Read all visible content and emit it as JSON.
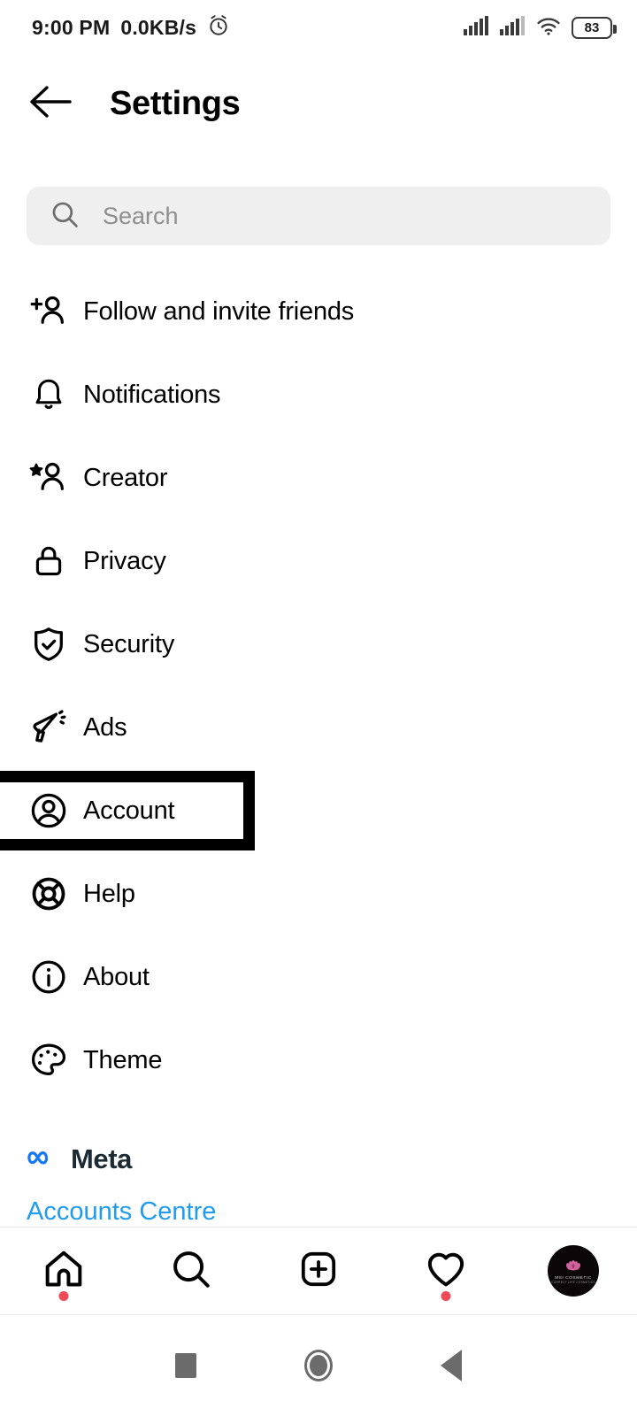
{
  "status_bar": {
    "time": "9:00 PM",
    "network_speed": "0.0KB/s",
    "alarm_icon": "alarm-clock-icon",
    "signal_1_icon": "signal-bars-icon",
    "signal_2_icon": "signal-bars-icon",
    "wifi_icon": "wifi-icon",
    "battery_level": "83"
  },
  "header": {
    "back_icon": "back-arrow-icon",
    "title": "Settings"
  },
  "search": {
    "icon": "search-icon",
    "placeholder": "Search",
    "value": ""
  },
  "settings_list": {
    "items": [
      {
        "label": "Follow and invite friends",
        "icon": "person-add-icon",
        "highlighted": false
      },
      {
        "label": "Notifications",
        "icon": "bell-icon",
        "highlighted": false
      },
      {
        "label": "Creator",
        "icon": "person-star-icon",
        "highlighted": false
      },
      {
        "label": "Privacy",
        "icon": "lock-icon",
        "highlighted": false
      },
      {
        "label": "Security",
        "icon": "shield-check-icon",
        "highlighted": false
      },
      {
        "label": "Ads",
        "icon": "megaphone-icon",
        "highlighted": false
      },
      {
        "label": "Account",
        "icon": "account-circle-icon",
        "highlighted": true
      },
      {
        "label": "Help",
        "icon": "life-ring-icon",
        "highlighted": false
      },
      {
        "label": "About",
        "icon": "info-circle-icon",
        "highlighted": false
      },
      {
        "label": "Theme",
        "icon": "palette-icon",
        "highlighted": false
      }
    ]
  },
  "footer": {
    "meta_logo_icon": "meta-infinity-icon",
    "meta_label": "Meta",
    "accounts_centre_label": "Accounts Centre",
    "link_color": "#1f9bf0",
    "meta_logo_color": "#1877f2"
  },
  "bottom_nav": {
    "items": [
      {
        "name": "home",
        "icon": "home-icon",
        "badge": true
      },
      {
        "name": "search",
        "icon": "search-icon",
        "badge": false
      },
      {
        "name": "create",
        "icon": "plus-square-icon",
        "badge": false
      },
      {
        "name": "activity",
        "icon": "heart-icon",
        "badge": true
      },
      {
        "name": "profile",
        "icon": "avatar-icon",
        "badge": false
      }
    ],
    "badge_color": "#ed4956",
    "avatar_text": "MSI COSMETIC",
    "avatar_subtext": "CORRECT LIFE COSMETICS"
  },
  "system_nav": {
    "recents_icon": "square-icon",
    "home_icon": "circle-icon",
    "back_icon": "triangle-back-icon"
  },
  "colors": {
    "background": "#ffffff",
    "text": "#000000",
    "muted_text": "#8e8e8e",
    "search_bg": "#efefef",
    "highlight_border": "#000000"
  }
}
